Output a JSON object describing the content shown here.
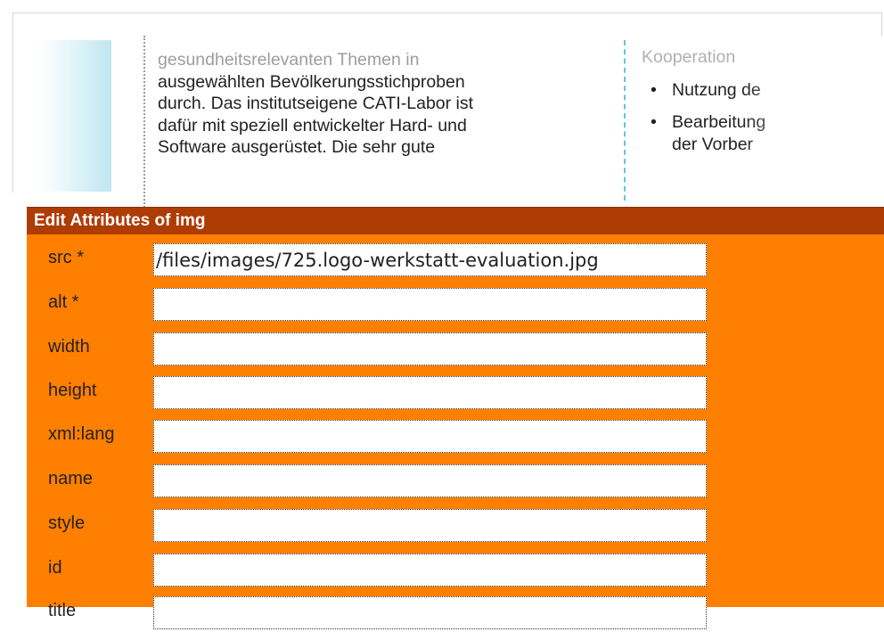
{
  "background_page": {
    "main_text_lines": [
      "gesundheitsrelevanten Themen in",
      "ausgewählten Bevölkerungsstichproben",
      "durch. Das institutseigene CATI-Labor ist",
      "dafür mit speziell entwickelter Hard- und",
      "Software ausgerüstet. Die sehr gute"
    ],
    "right_heading": "Kooperation",
    "right_items": [
      {
        "bullet": "•",
        "text": "Nutzung de"
      },
      {
        "bullet": "•",
        "text": "Bearbeitung",
        "text2": "der Vorber"
      }
    ]
  },
  "dialog": {
    "title": "Edit Attributes of img",
    "fields": [
      {
        "label": "src *",
        "value": "/files/images/725.logo-werkstatt-evaluation.jpg"
      },
      {
        "label": "alt *",
        "value": ""
      },
      {
        "label": "width",
        "value": ""
      },
      {
        "label": "height",
        "value": ""
      },
      {
        "label": "xml:lang",
        "value": ""
      },
      {
        "label": "name",
        "value": ""
      },
      {
        "label": "style",
        "value": ""
      },
      {
        "label": "id",
        "value": ""
      },
      {
        "label": "title",
        "value": ""
      }
    ]
  },
  "colors": {
    "dialog_bg": "#ff7f00",
    "dialog_title_bg": "#ae3c05",
    "separator_cyan": "#5fc7de"
  }
}
